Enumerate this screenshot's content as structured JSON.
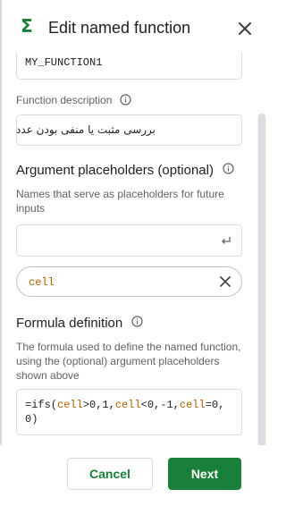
{
  "dialog": {
    "title": "Edit named function",
    "icon": "sigma-icon",
    "close_icon": "close-icon"
  },
  "function_name": {
    "value": "MY_FUNCTION1"
  },
  "function_description": {
    "label": "Function description",
    "value": "بررسی مثبت یا منفی بودن عدد"
  },
  "argument_placeholders": {
    "heading": "Argument placeholders (optional)",
    "help": "Names that serve as placeholders for future inputs",
    "input_value": "",
    "chips": [
      {
        "label": "cell"
      }
    ]
  },
  "formula_definition": {
    "heading": "Formula definition",
    "help": "The formula used to define the named function, using the (optional) argument placeholders shown above",
    "tokens": [
      "=ifs(",
      "cell",
      ">0,1,",
      "cell",
      "<0,-1,",
      "cell",
      "=0,0",
      ")"
    ]
  },
  "footer": {
    "cancel_label": "Cancel",
    "next_label": "Next"
  },
  "colors": {
    "accent_green": "#188038",
    "argument_ref": "#b06000"
  }
}
